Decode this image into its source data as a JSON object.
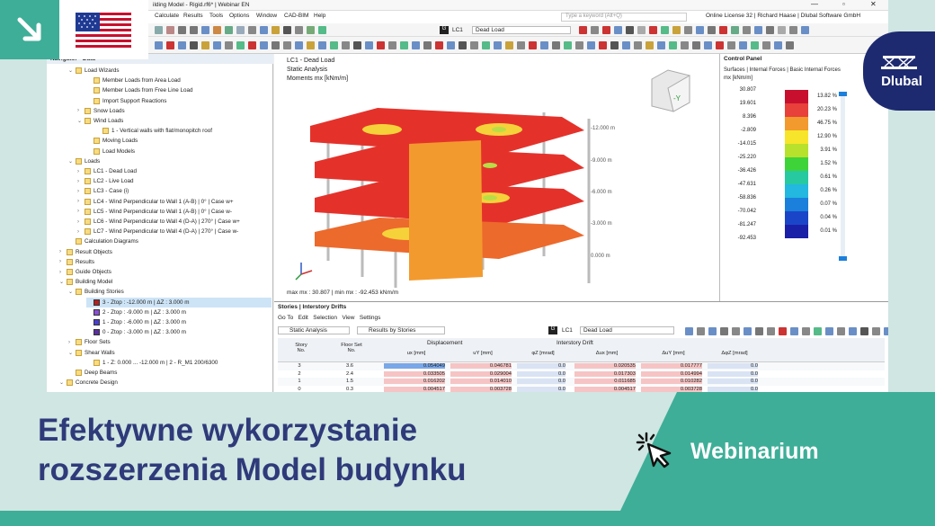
{
  "window_title": "ilding Model - Rigid.rf6* | Webinar EN",
  "menu": [
    "Calculate",
    "Results",
    "Tools",
    "Options",
    "Window",
    "CAD-BIM",
    "Help"
  ],
  "search_placeholder": "Type a keyword (Alt+Q)",
  "license": "Online License 32 | Richard Haase | Dlubal Software GmbH",
  "toolbar_lc": {
    "tag": "G",
    "case": "LC1",
    "name": "Dead Load"
  },
  "navigator": {
    "title": "Navigator - Data",
    "items": [
      {
        "label": "Load Wizards",
        "indent": 1,
        "chev": "⌄"
      },
      {
        "label": "Member Loads from Area Load",
        "indent": 3,
        "chev": ""
      },
      {
        "label": "Member Loads from Free Line Load",
        "indent": 3,
        "chev": ""
      },
      {
        "label": "Import Support Reactions",
        "indent": 3,
        "chev": ""
      },
      {
        "label": "Snow Loads",
        "indent": 2,
        "chev": "›"
      },
      {
        "label": "Wind Loads",
        "indent": 2,
        "chev": "⌄"
      },
      {
        "label": "1 - Vertical walls with flat/monopitch roof",
        "indent": 4,
        "chev": ""
      },
      {
        "label": "Moving Loads",
        "indent": 3,
        "chev": ""
      },
      {
        "label": "Load Models",
        "indent": 3,
        "chev": ""
      },
      {
        "label": "Loads",
        "indent": 1,
        "chev": "⌄"
      },
      {
        "label": "LC1 - Dead Load",
        "indent": 2,
        "chev": "›"
      },
      {
        "label": "LC2 - Live Load",
        "indent": 2,
        "chev": "›"
      },
      {
        "label": "LC3 - Case (i)",
        "indent": 2,
        "chev": "›"
      },
      {
        "label": "LC4 - Wind Perpendicular to Wall 1 (A-B) | 0° | Case w+",
        "indent": 2,
        "chev": "›"
      },
      {
        "label": "LC5 - Wind Perpendicular to Wall 1 (A-B) | 0° | Case w-",
        "indent": 2,
        "chev": "›"
      },
      {
        "label": "LC6 - Wind Perpendicular to Wall 4 (D-A) | 270° | Case w+",
        "indent": 2,
        "chev": "›"
      },
      {
        "label": "LC7 - Wind Perpendicular to Wall 4 (D-A) | 270° | Case w-",
        "indent": 2,
        "chev": "›"
      },
      {
        "label": "Calculation Diagrams",
        "indent": 1,
        "chev": ""
      },
      {
        "label": "Result Objects",
        "indent": 0,
        "chev": "›"
      },
      {
        "label": "Results",
        "indent": 0,
        "chev": "›"
      },
      {
        "label": "Guide Objects",
        "indent": 0,
        "chev": "›"
      },
      {
        "label": "Building Model",
        "indent": 0,
        "chev": "⌄"
      },
      {
        "label": "Building Stories",
        "indent": 1,
        "chev": "⌄"
      },
      {
        "label": "3 - Ztop : -12.000 m | ΔZ : 3.000 m",
        "indent": 3,
        "chev": "",
        "sel": true,
        "color": "#b22222"
      },
      {
        "label": "2 - Ztop : -9.000 m | ΔZ : 3.000 m",
        "indent": 3,
        "chev": "",
        "color": "#8a4fd6"
      },
      {
        "label": "1 - Ztop : -6.000 m | ΔZ : 3.000 m",
        "indent": 3,
        "chev": "",
        "color": "#4b3fcf"
      },
      {
        "label": "0 - Ztop : -3.000 m | ΔZ : 3.000 m",
        "indent": 3,
        "chev": "",
        "color": "#5a2fa0"
      },
      {
        "label": "Floor Sets",
        "indent": 1,
        "chev": "›"
      },
      {
        "label": "Shear Walls",
        "indent": 1,
        "chev": "⌄"
      },
      {
        "label": "1 - Z: 0.000 ... -12.000 m | 2 - R_M1 200/6300",
        "indent": 3,
        "chev": ""
      },
      {
        "label": "Deep Beams",
        "indent": 1,
        "chev": ""
      },
      {
        "label": "Concrete Design",
        "indent": 0,
        "chev": "⌄"
      }
    ]
  },
  "viewport": {
    "line1": "LC1 - Dead Load",
    "line2": "Static Analysis",
    "line3": "Moments mx [kNm/m]",
    "levels": [
      "-12.000 m",
      "-9.000 m",
      "-6.000 m",
      "-3.000 m",
      "0.000 m"
    ],
    "footer": "max mx : 30.807 | min mx : -92.453 kNm/m"
  },
  "control_panel": {
    "title": "Control Panel",
    "subtitle": "Surfaces | Internal Forces | Basic Internal Forces",
    "unit": "mx [kNm/m]",
    "values": [
      "30.807",
      "19.601",
      "8.396",
      "-2.809",
      "-14.015",
      "-25.220",
      "-36.426",
      "-47.631",
      "-58.836",
      "-70.042",
      "-81.247",
      "-92.453"
    ],
    "percents": [
      "13.82 %",
      "20.23 %",
      "46.75 %",
      "12.90 %",
      "3.91 %",
      "1.52 %",
      "0.61 %",
      "0.26 %",
      "0.07 %",
      "0.04 %",
      "0.01 %"
    ],
    "colors": [
      "#c8102e",
      "#e8403a",
      "#f29a2e",
      "#f6e52a",
      "#b7e12c",
      "#3fd33a",
      "#26c9a0",
      "#22b8e0",
      "#1b7fdc",
      "#1b45c8",
      "#1a1fa8"
    ]
  },
  "stories_panel": {
    "title": "Stories | Interstory Drifts",
    "menu": [
      "Go To",
      "Edit",
      "Selection",
      "View",
      "Settings"
    ],
    "analysis": "Static Analysis",
    "results_by": "Results by Stories",
    "lc_tag": "G",
    "lc": "LC1",
    "lc_name": "Dead Load",
    "group_disp": "Displacement",
    "group_drift": "Interstory Drift",
    "headers": [
      "Story\nNo.",
      "Floor Set\nNo.",
      "ux [mm]",
      "uY [mm]",
      "φZ [mrad]",
      "Δux [mm]",
      "ΔuY [mm]",
      "ΔφZ [mrad]"
    ],
    "rows": [
      [
        "3",
        "3.6",
        "0.054049",
        "0.046781",
        "0.0",
        "0.020535",
        "0.017777",
        "0.0"
      ],
      [
        "2",
        "2.4",
        "0.033505",
        "0.029004",
        "0.0",
        "0.017303",
        "0.014994",
        "0.0"
      ],
      [
        "1",
        "1.5",
        "0.016202",
        "0.014010",
        "0.0",
        "0.011685",
        "0.010282",
        "0.0"
      ],
      [
        "0",
        "0.3",
        "0.004517",
        "0.003728",
        "0.0",
        "0.004517",
        "0.003728",
        "0.0"
      ]
    ]
  },
  "banner": {
    "headline_line1": "Efektywne wykorzystanie",
    "headline_line2": "rozszerzenia Model budynku",
    "label": "Webinarium"
  },
  "brand": {
    "name": "Dlubal",
    "color": "#1e2a70",
    "accent": "#3eae98"
  }
}
